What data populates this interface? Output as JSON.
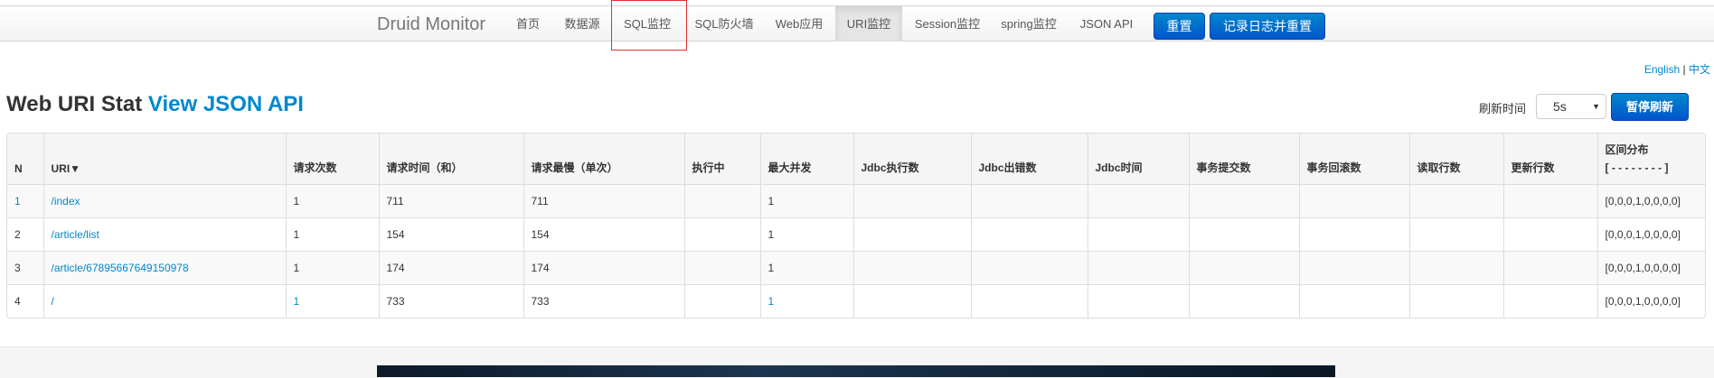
{
  "navbar": {
    "brand": "Druid Monitor",
    "items": [
      {
        "label": "首页"
      },
      {
        "label": "数据源"
      },
      {
        "label": "SQL监控"
      },
      {
        "label": "SQL防火墙"
      },
      {
        "label": "Web应用"
      },
      {
        "label": "URI监控"
      },
      {
        "label": "Session监控"
      },
      {
        "label": "spring监控"
      },
      {
        "label": "JSON API"
      }
    ],
    "active": "URI监控",
    "reset_label": "重置",
    "log_reset_label": "记录日志并重置"
  },
  "lang": {
    "english": "English",
    "separator": "|",
    "chinese": "中文"
  },
  "title": {
    "main": "Web URI Stat",
    "link": "View JSON API"
  },
  "refresh": {
    "label": "刷新时间",
    "selected": "5s",
    "pause_label": "暂停刷新"
  },
  "table": {
    "columns": [
      "N",
      "URI▼",
      "请求次数",
      "请求时间（和）",
      "请求最慢（单次）",
      "执行中",
      "最大并发",
      "Jdbc执行数",
      "Jdbc出错数",
      "Jdbc时间",
      "事务提交数",
      "事务回滚数",
      "读取行数",
      "更新行数",
      "区间分布"
    ],
    "distribution_header_sub": "[ - - - - - - - - ]",
    "rows": [
      {
        "n": "1",
        "uri": "/index",
        "count": "1",
        "time_sum": "711",
        "time_max": "711",
        "running": "",
        "concurrent_max": "1",
        "jdbc_exec": "",
        "jdbc_error": "",
        "jdbc_time": "",
        "tx_commit": "",
        "tx_rollback": "",
        "fetch_rows": "",
        "update_rows": "",
        "histogram": "[0,0,0,1,0,0,0,0]"
      },
      {
        "n": "2",
        "uri": "/article/list",
        "count": "1",
        "time_sum": "154",
        "time_max": "154",
        "running": "",
        "concurrent_max": "1",
        "jdbc_exec": "",
        "jdbc_error": "",
        "jdbc_time": "",
        "tx_commit": "",
        "tx_rollback": "",
        "fetch_rows": "",
        "update_rows": "",
        "histogram": "[0,0,0,1,0,0,0,0]"
      },
      {
        "n": "3",
        "uri": "/article/67895667649150978",
        "count": "1",
        "time_sum": "174",
        "time_max": "174",
        "running": "",
        "concurrent_max": "1",
        "jdbc_exec": "",
        "jdbc_error": "",
        "jdbc_time": "",
        "tx_commit": "",
        "tx_rollback": "",
        "fetch_rows": "",
        "update_rows": "",
        "histogram": "[0,0,0,1,0,0,0,0]"
      },
      {
        "n": "4",
        "uri": "/",
        "count": "1",
        "time_sum": "733",
        "time_max": "733",
        "running": "",
        "concurrent_max": "1",
        "jdbc_exec": "",
        "jdbc_error": "",
        "jdbc_time": "",
        "tx_commit": "",
        "tx_rollback": "",
        "fetch_rows": "",
        "update_rows": "",
        "histogram": "[0,0,0,1,0,0,0,0]"
      }
    ]
  },
  "colors": {
    "primary": "#0088cc",
    "highlight_box": "#e03030"
  }
}
